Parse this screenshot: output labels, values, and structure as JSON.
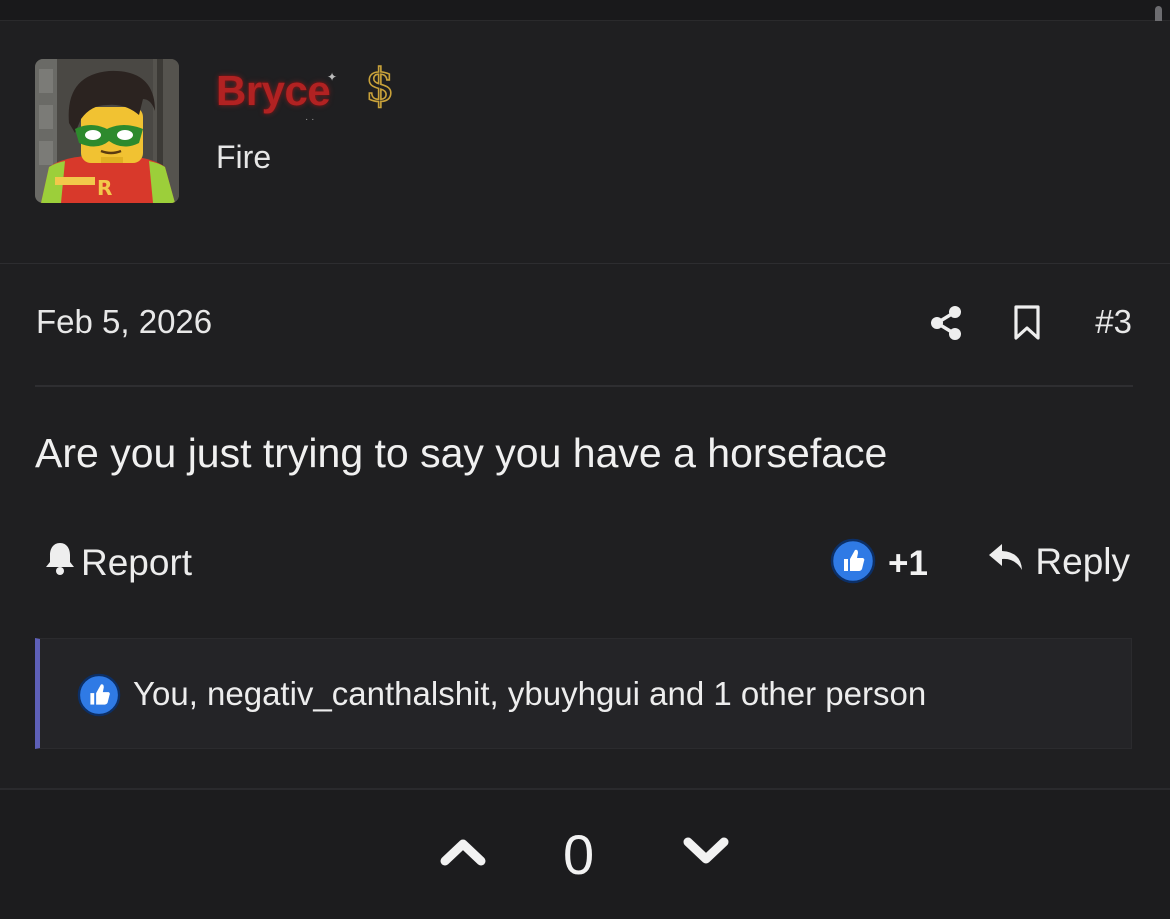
{
  "post": {
    "username": "Bryce",
    "user_title": "Fire",
    "date": "Feb 5, 2026",
    "post_number": "#3",
    "body": "Are you just trying to say you have a horseface"
  },
  "actions": {
    "report_label": "Report",
    "reaction_count": "+1",
    "reply_label": "Reply"
  },
  "reactions": {
    "summary": "You, negativ_canthalshit, ybuyhgui and 1 other person"
  },
  "votes": {
    "score": "0"
  },
  "colors": {
    "background": "#1f1f21",
    "username": "#b12222",
    "accent_bar": "#5e60b8",
    "like_blue": "#2f7ae5",
    "badge_gold": "#c9a23a"
  },
  "icons": [
    "share-icon",
    "bookmark-icon",
    "bell-icon",
    "like-icon",
    "reply-icon",
    "chevron-up-icon",
    "chevron-down-icon",
    "dollar-badge-icon"
  ]
}
